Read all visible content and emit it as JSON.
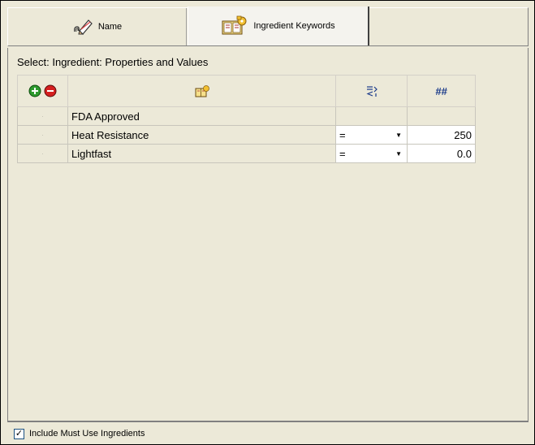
{
  "tabs": {
    "name_label": "Name",
    "keywords_label": "Ingredient Keywords",
    "name_icon": "pencil-paperclip-icon",
    "keywords_icon": "book-key-icon"
  },
  "panel": {
    "label": "Select: Ingredient: Properties and Values"
  },
  "grid": {
    "header_icons": {
      "add": "add-icon",
      "remove": "remove-icon",
      "property": "book-key-icon",
      "operator": "compare-operator-icon",
      "value": "##"
    },
    "rows": [
      {
        "name": "FDA Approved",
        "operator": "",
        "value": ""
      },
      {
        "name": "Heat Resistance",
        "operator": "=",
        "value": "250"
      },
      {
        "name": "Lightfast",
        "operator": "=",
        "value": "0.0"
      }
    ]
  },
  "footer": {
    "checkbox_label": "Include Must Use Ingredients",
    "checked": true
  },
  "colors": {
    "background": "#ece9d8",
    "add_green": "#2e9a2e",
    "remove_red": "#d42020"
  }
}
